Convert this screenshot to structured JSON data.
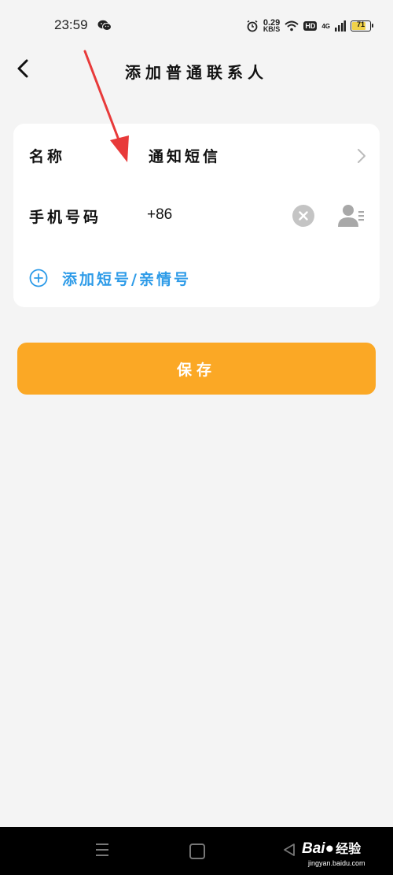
{
  "status_bar": {
    "time": "23:59",
    "net_speed_value": "0.29",
    "net_speed_unit": "KB/S",
    "hd_label": "HD",
    "network_type": "4G",
    "battery_level": "71"
  },
  "header": {
    "title": "添加普通联系人"
  },
  "form": {
    "name_label": "名称",
    "name_value": "通知短信",
    "phone_label": "手机号码",
    "phone_value": "+86",
    "add_short_number_label": "添加短号/亲情号"
  },
  "actions": {
    "save_label": "保存"
  },
  "watermark": {
    "brand_text": "Bai",
    "brand_suffix": "经验",
    "url": "jingyan.baidu.com"
  },
  "colors": {
    "accent_orange": "#fba825",
    "link_blue": "#2d9be8",
    "annotation_red": "#e83a3a",
    "background": "#f4f4f4"
  }
}
